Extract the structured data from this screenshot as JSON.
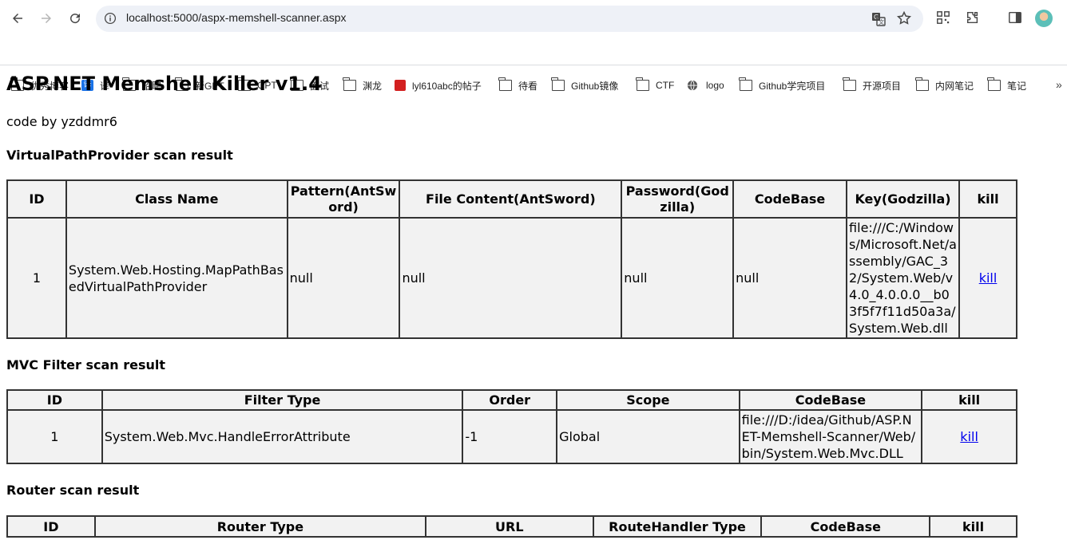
{
  "browser": {
    "url": "localhost:5000/aspx-memshell-scanner.aspx",
    "bookmarks": [
      {
        "label": "优秀博客",
        "icon": "folder-icon"
      },
      {
        "label": "译",
        "icon": "translate-app-icon"
      },
      {
        "label": "招聘",
        "icon": "folder-icon"
      },
      {
        "label": "新GPT",
        "icon": "folder-icon"
      },
      {
        "label": "GPT",
        "icon": "folder-icon"
      },
      {
        "label": "面试",
        "icon": "folder-icon"
      },
      {
        "label": "渊龙",
        "icon": "folder-icon"
      },
      {
        "label": "lyl610abc的帖子",
        "icon": "site-favicon-icon"
      },
      {
        "label": "待看",
        "icon": "folder-icon"
      },
      {
        "label": "Github镜像",
        "icon": "folder-icon"
      },
      {
        "label": "CTF",
        "icon": "folder-icon"
      },
      {
        "label": "logo",
        "icon": "globe-icon"
      },
      {
        "label": "Github学完项目",
        "icon": "folder-icon"
      },
      {
        "label": "开源项目",
        "icon": "folder-icon"
      },
      {
        "label": "内网笔记",
        "icon": "folder-icon"
      },
      {
        "label": "笔记",
        "icon": "folder-icon"
      }
    ],
    "overflow": "»"
  },
  "page": {
    "title": "ASP.NET Memshell Killer v1.4",
    "byline": "code by yzddmr6",
    "sections": {
      "vpp": {
        "heading": "VirtualPathProvider scan result",
        "headers": [
          "ID",
          "Class Name",
          "Pattern(AntSword)",
          "File Content(AntSword)",
          "Password(Godzilla)",
          "CodeBase",
          "Key(Godzilla)",
          "kill"
        ],
        "row": {
          "id": "1",
          "class_name": "System.Web.Hosting.MapPathBasedVirtualPathProvider",
          "pattern": "null",
          "file_content": "null",
          "password": "null",
          "codebase": "null",
          "key": "file:///C:/Windows/Microsoft.Net/assembly/GAC_32/System.Web/v4.0_4.0.0.0__b03f5f7f11d50a3a/System.Web.dll",
          "kill": "kill"
        }
      },
      "mvc": {
        "heading": "MVC Filter scan result",
        "headers": [
          "ID",
          "Filter Type",
          "Order",
          "Scope",
          "CodeBase",
          "kill"
        ],
        "row": {
          "id": "1",
          "filter_type": "System.Web.Mvc.HandleErrorAttribute",
          "order": "-1",
          "scope": "Global",
          "codebase": "file:///D:/idea/Github/ASP.NET-Memshell-Scanner/Web/bin/System.Web.Mvc.DLL",
          "kill": "kill"
        }
      },
      "router": {
        "heading": "Router scan result",
        "headers": [
          "ID",
          "Router Type",
          "URL",
          "RouteHandler Type",
          "CodeBase",
          "kill"
        ]
      }
    }
  }
}
